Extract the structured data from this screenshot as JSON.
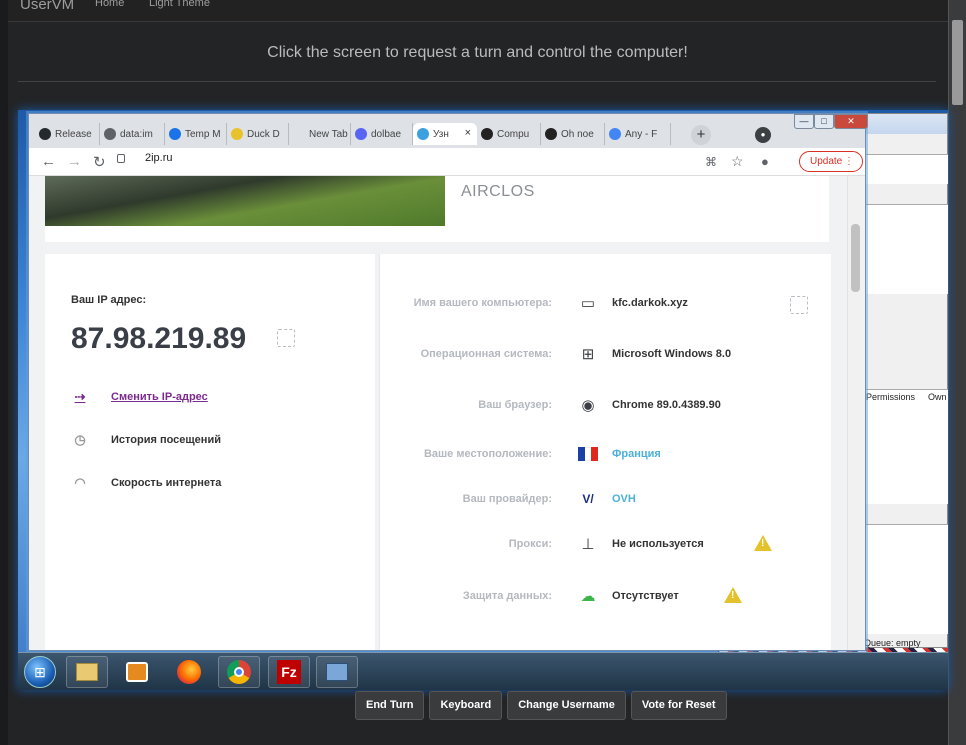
{
  "site": {
    "brand": "UserVM",
    "nav": [
      "Home",
      "Light Theme"
    ],
    "banner": "Click the screen to request a turn and control the computer!"
  },
  "browser": {
    "tabs": [
      {
        "label": "Release",
        "color": "#24292e"
      },
      {
        "label": "data:im",
        "color": "#5f6368"
      },
      {
        "label": "Temp M",
        "color": "#1a73e8"
      },
      {
        "label": "Duck D",
        "color": "#e8c22b"
      },
      {
        "label": "New Tab",
        "color": "#dee1e6"
      },
      {
        "label": "dolbae",
        "color": "#5865f2"
      },
      {
        "label": "Узн",
        "color": "#3aa0e0"
      },
      {
        "label": "Compu",
        "color": "#222"
      },
      {
        "label": "Oh noe",
        "color": "#222"
      },
      {
        "label": "Any - F",
        "color": "#4285f4"
      }
    ],
    "new_tab": "+",
    "url": "2ip.ru",
    "update_label": "Update",
    "window_buttons": [
      "—",
      "□",
      "✕"
    ]
  },
  "page": {
    "brand_text": "AIRCLOS",
    "ip_label": "Ваш IP адрес:",
    "ip_value": "87.98.219.89",
    "actions": [
      {
        "label": "Сменить IP-адрес",
        "icon": "change-ip-icon"
      },
      {
        "label": "История посещений",
        "icon": "history-icon"
      },
      {
        "label": "Скорость интернета",
        "icon": "speed-icon"
      }
    ],
    "rows": [
      {
        "label": "Имя вашего компьютера:",
        "value": "kfc.darkok.xyz",
        "icon": "computer-icon"
      },
      {
        "label": "Операционная система:",
        "value": "Microsoft Windows 8.0",
        "icon": "windows-icon"
      },
      {
        "label": "Ваш браузер:",
        "value": "Chrome 89.0.4389.90",
        "icon": "chrome-icon"
      },
      {
        "label": "Ваше местоположение:",
        "value": "Франция",
        "icon": "france-flag-icon"
      },
      {
        "label": "Ваш провайдер:",
        "value": "OVH",
        "icon": "ovh-logo-icon"
      },
      {
        "label": "Прокси:",
        "value": "Не используется",
        "icon": "proxy-icon"
      },
      {
        "label": "Защита данных:",
        "value": "Отсутствует",
        "icon": "cloud-lock-icon"
      }
    ]
  },
  "bg_window": {
    "col1": "Permissions",
    "col2": "Own",
    "status": "Queue: empty"
  },
  "controls": [
    "End Turn",
    "Keyboard",
    "Change Username",
    "Vote for Reset"
  ]
}
